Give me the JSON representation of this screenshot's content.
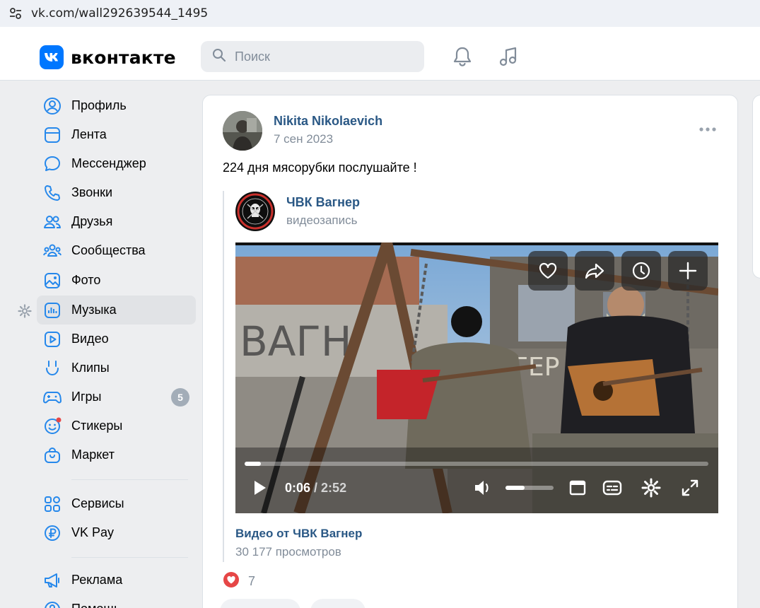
{
  "browser": {
    "url": "vk.com/wall292639544_1495"
  },
  "header": {
    "logo_text": "вконтакте",
    "search_placeholder": "Поиск",
    "brand_color": "#0077ff"
  },
  "sidebar": {
    "items": [
      {
        "label": "Профиль",
        "icon": "user-circle-icon"
      },
      {
        "label": "Лента",
        "icon": "feed-icon"
      },
      {
        "label": "Мессенджер",
        "icon": "message-bubble-icon"
      },
      {
        "label": "Звонки",
        "icon": "phone-icon"
      },
      {
        "label": "Друзья",
        "icon": "friends-icon"
      },
      {
        "label": "Сообщества",
        "icon": "communities-icon"
      },
      {
        "label": "Фото",
        "icon": "photo-icon"
      },
      {
        "label": "Музыка",
        "icon": "music-icon",
        "active": true
      },
      {
        "label": "Видео",
        "icon": "video-icon"
      },
      {
        "label": "Клипы",
        "icon": "clips-icon"
      },
      {
        "label": "Игры",
        "icon": "gamepad-icon",
        "badge": "5"
      },
      {
        "label": "Стикеры",
        "icon": "sticker-icon"
      },
      {
        "label": "Маркет",
        "icon": "market-bag-icon"
      },
      {
        "label": "Сервисы",
        "icon": "services-grid-icon"
      },
      {
        "label": "VK Pay",
        "icon": "vkpay-icon"
      },
      {
        "label": "Реклама",
        "icon": "megaphone-icon"
      },
      {
        "label": "Помощь",
        "icon": "help-icon"
      }
    ]
  },
  "post": {
    "author": "Nikita Nikolaevich",
    "date": "7 сен 2023",
    "text": "224 дня мясорубки послушайте !",
    "repost": {
      "source_name": "ЧВК Вагнер",
      "source_type": "видеозапись"
    },
    "video": {
      "time_current": "0:06",
      "time_separator": " / ",
      "time_total": "2:52",
      "progress": 0.035,
      "volume": 0.4,
      "title": "Видео от ЧВК Вагнер",
      "views": "30 177 просмотров"
    },
    "likes": "7"
  },
  "colors": {
    "link": "#2a5885",
    "muted": "#818c99",
    "like": "#e64646"
  }
}
